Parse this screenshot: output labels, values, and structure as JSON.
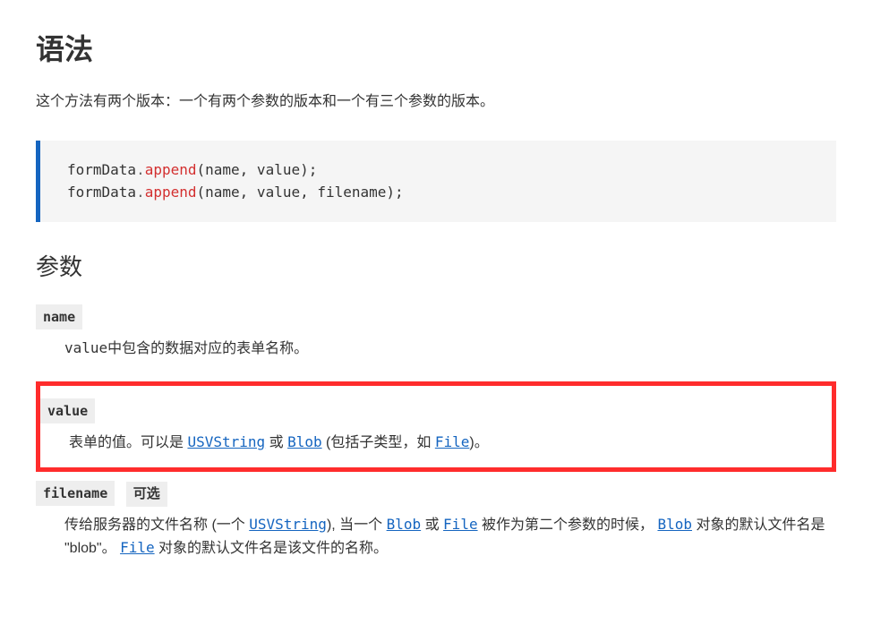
{
  "heading_syntax": "语法",
  "intro": "这个方法有两个版本：一个有两个参数的版本和一个有三个参数的版本。",
  "code": {
    "obj": "formData",
    "method": "append",
    "l1_args": "(name, value);",
    "l2_args": "(name, value, filename);"
  },
  "heading_params": "参数",
  "params": {
    "name": {
      "term": "name",
      "def_prefix_code": "value",
      "def_text": "中包含的数据对应的表单名称。"
    },
    "value": {
      "term": "value",
      "def_t1": "表单的值。可以是 ",
      "link_usv": "USVString",
      "def_t2": " 或 ",
      "link_blob": "Blob",
      "def_t3": " (包括子类型，如 ",
      "link_file": "File",
      "def_t4": ")。"
    },
    "filename": {
      "term": "filename",
      "optional": "可选",
      "def_t1": "传给服务器的文件名称 (一个 ",
      "link_usv": "USVString",
      "def_t2": "), 当一个 ",
      "link_blob": "Blob",
      "def_t3": " 或 ",
      "link_file": "File",
      "def_t4": " 被作为第二个参数的时候， ",
      "link_blob2": "Blob",
      "def_t5": " 对象的默认文件名是 \"blob\"。 ",
      "link_file2": "File",
      "def_t6": " 对象的默认文件名是该文件的名称。"
    }
  }
}
